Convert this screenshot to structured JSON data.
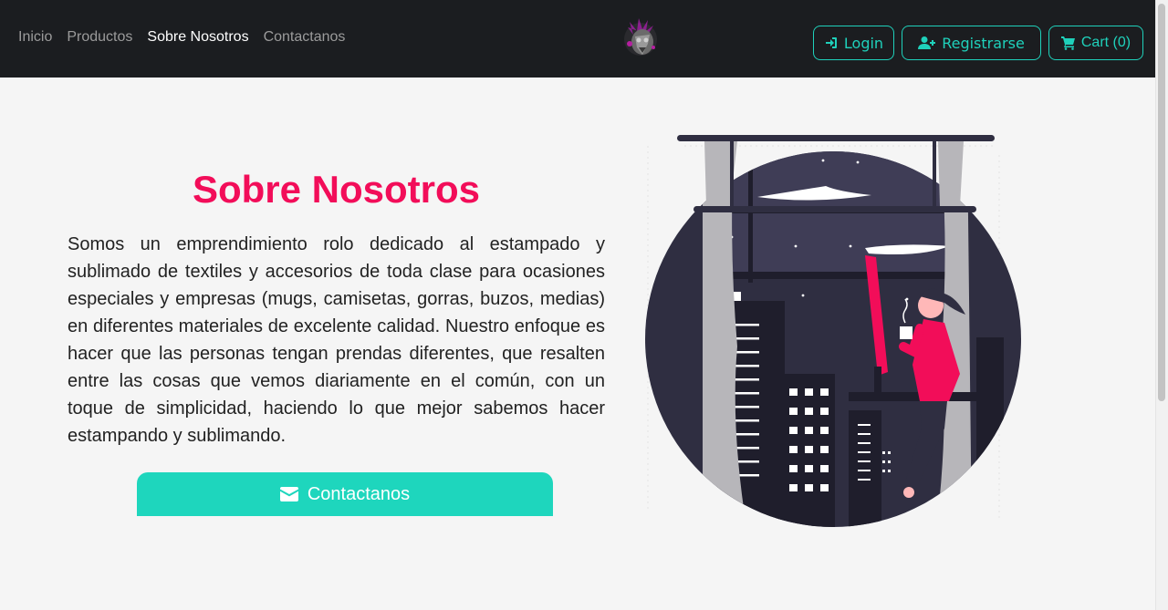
{
  "nav": {
    "links": [
      {
        "label": "Inicio",
        "active": false
      },
      {
        "label": "Productos",
        "active": false
      },
      {
        "label": "Sobre Nosotros",
        "active": true
      },
      {
        "label": "Contactanos",
        "active": false
      }
    ],
    "login_label": "Login",
    "register_label": "Registrarse",
    "cart_label": "Cart (0)"
  },
  "about": {
    "title": "Sobre Nosotros",
    "text": "Somos un emprendimiento rolo dedicado al estampado y sublimado de textiles y accesorios de toda clase para ocasiones especiales y empresas (mugs, camisetas, gorras, buzos, medias) en diferentes materiales de excelente calidad. Nuestro enfoque es hacer que las personas tengan prendas diferentes, que resalten entre las cosas que vemos diariamente en el común, con un toque de simplicidad, haciendo lo que mejor sabemos hacer estampando y sublimando.",
    "contact_button_label": "Contactanos"
  },
  "icons": {
    "login": "sign-in-icon",
    "register": "user-plus-icon",
    "cart": "cart-icon",
    "contact": "envelope-icon"
  },
  "colors": {
    "navbar_bg": "#1b1d20",
    "accent": "#1fd1bb",
    "title": "#f20d59",
    "page_bg": "#f5f5f5"
  }
}
